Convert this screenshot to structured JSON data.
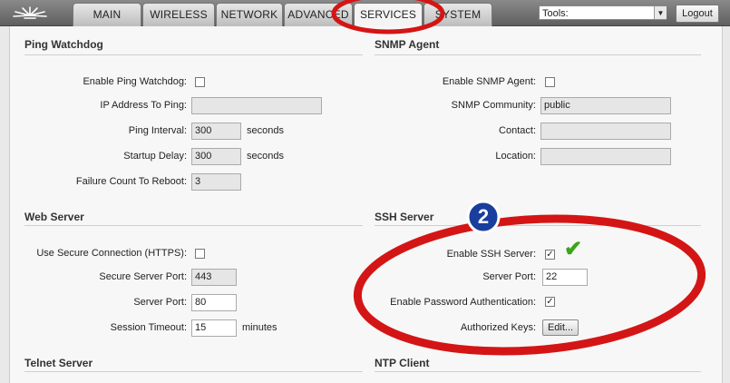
{
  "nav": {
    "tabs": [
      "MAIN",
      "WIRELESS",
      "NETWORK",
      "ADVANCED",
      "SERVICES",
      "SYSTEM"
    ],
    "active_tab": "SERVICES",
    "tools_label": "Tools:",
    "logout_label": "Logout"
  },
  "ping_watchdog": {
    "title": "Ping Watchdog",
    "enable_label": "Enable Ping Watchdog:",
    "enable_checked": false,
    "ip_label": "IP Address To Ping:",
    "ip_value": "",
    "interval_label": "Ping Interval:",
    "interval_value": "300",
    "interval_unit": "seconds",
    "startup_label": "Startup Delay:",
    "startup_value": "300",
    "startup_unit": "seconds",
    "failure_label": "Failure Count To Reboot:",
    "failure_value": "3"
  },
  "snmp": {
    "title": "SNMP Agent",
    "enable_label": "Enable SNMP Agent:",
    "enable_checked": false,
    "community_label": "SNMP Community:",
    "community_value": "public",
    "contact_label": "Contact:",
    "contact_value": "",
    "location_label": "Location:",
    "location_value": ""
  },
  "web_server": {
    "title": "Web Server",
    "https_label": "Use Secure Connection (HTTPS):",
    "https_checked": false,
    "secure_port_label": "Secure Server Port:",
    "secure_port_value": "443",
    "port_label": "Server Port:",
    "port_value": "80",
    "timeout_label": "Session Timeout:",
    "timeout_value": "15",
    "timeout_unit": "minutes"
  },
  "ssh": {
    "title": "SSH Server",
    "enable_label": "Enable SSH Server:",
    "enable_checked": true,
    "port_label": "Server Port:",
    "port_value": "22",
    "password_label": "Enable Password Authentication:",
    "password_checked": true,
    "keys_label": "Authorized Keys:",
    "keys_button": "Edit..."
  },
  "telnet": {
    "title": "Telnet Server"
  },
  "ntp": {
    "title": "NTP Client"
  },
  "annotation": {
    "step_number": "2",
    "check_glyph": "✔",
    "ring_color": "#d41515",
    "badge_color": "#1a3e9e",
    "check_color": "#3aa51a"
  }
}
